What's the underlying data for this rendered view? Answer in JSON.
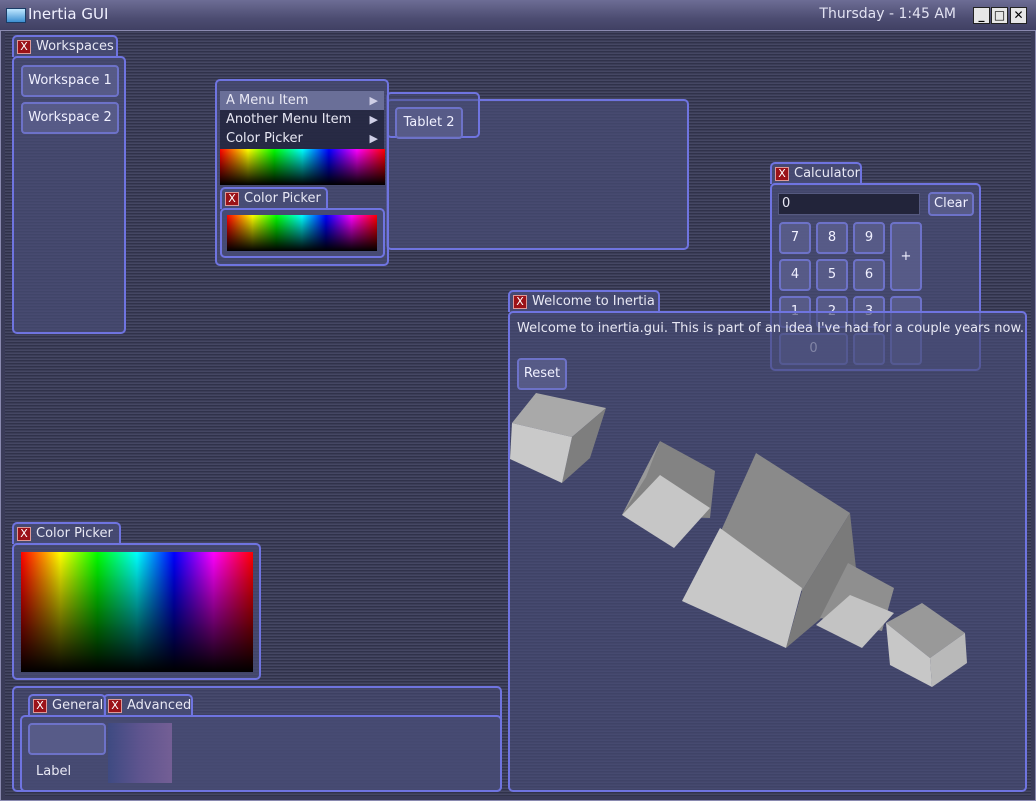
{
  "window": {
    "title": "Inertia GUI",
    "clock": "Thursday - 1:45 AM",
    "controls": {
      "minimize": "_",
      "maximize": "□",
      "close": "✕"
    }
  },
  "close_glyph": "X",
  "workspaces": {
    "title": "Workspaces",
    "items": [
      "Workspace 1",
      "Workspace 2"
    ]
  },
  "menu": {
    "items": [
      "A Menu Item",
      "Another Menu Item",
      "Color Picker"
    ],
    "arrow": "▶",
    "color_picker_title": "Color Picker"
  },
  "tablet": {
    "tab_label": "Tablet 2"
  },
  "calculator": {
    "title": "Calculator",
    "display": "0",
    "clear": "Clear",
    "keys": [
      "7",
      "8",
      "9",
      "4",
      "5",
      "6",
      "1",
      "2",
      "3",
      "0"
    ],
    "plus": "+"
  },
  "welcome": {
    "title": "Welcome to Inertia",
    "text": "Welcome to inertia.gui.  This is part of an idea I've had for a couple years now.",
    "reset": "Reset"
  },
  "color_picker_large": {
    "title": "Color Picker"
  },
  "tabs_panel": {
    "tabs": [
      "General",
      "Advanced"
    ],
    "label": "Label"
  },
  "colors": {
    "accent_border": "#6f74e0",
    "panel_fill": "#484c76",
    "close_red": "#9b1218"
  }
}
